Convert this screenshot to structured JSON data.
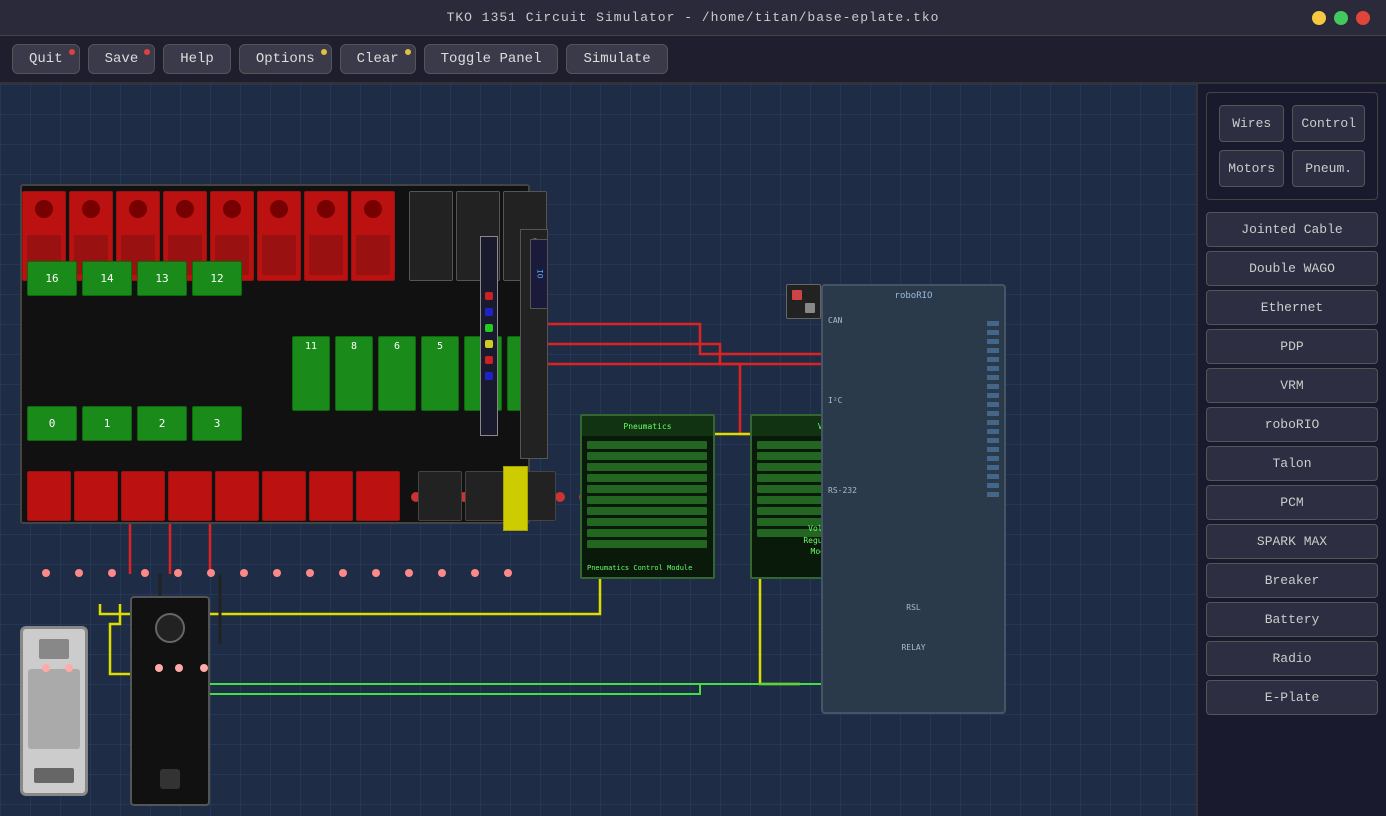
{
  "titlebar": {
    "title": "TKO 1351 Circuit Simulator - /home/titan/base-eplate.tko"
  },
  "window_controls": {
    "minimize_label": "minimize",
    "maximize_label": "maximize",
    "close_label": "close"
  },
  "toolbar": {
    "buttons": [
      {
        "id": "quit",
        "label": "Quit",
        "dot": "red"
      },
      {
        "id": "save",
        "label": "Save",
        "dot": "red"
      },
      {
        "id": "help",
        "label": "Help",
        "dot": "none"
      },
      {
        "id": "options",
        "label": "Options",
        "dot": "yellow"
      },
      {
        "id": "clear",
        "label": "Clear",
        "dot": "yellow"
      },
      {
        "id": "toggle-panel",
        "label": "Toggle Panel",
        "dot": "none"
      },
      {
        "id": "simulate",
        "label": "Simulate",
        "dot": "none"
      }
    ]
  },
  "top_panel": {
    "buttons": [
      {
        "id": "wires",
        "label": "Wires"
      },
      {
        "id": "control",
        "label": "Control"
      },
      {
        "id": "motors",
        "label": "Motors"
      },
      {
        "id": "pneum",
        "label": "Pneum."
      }
    ]
  },
  "components": [
    {
      "id": "jointed-cable",
      "label": "Jointed Cable"
    },
    {
      "id": "double-wago",
      "label": "Double WAGO"
    },
    {
      "id": "ethernet",
      "label": "Ethernet"
    },
    {
      "id": "pdp",
      "label": "PDP"
    },
    {
      "id": "vrm",
      "label": "VRM"
    },
    {
      "id": "roborio",
      "label": "roboRIO"
    },
    {
      "id": "talon",
      "label": "Talon"
    },
    {
      "id": "pcm",
      "label": "PCM"
    },
    {
      "id": "spark-max",
      "label": "SPARK MAX"
    },
    {
      "id": "breaker",
      "label": "Breaker"
    },
    {
      "id": "battery",
      "label": "Battery"
    },
    {
      "id": "radio",
      "label": "Radio"
    },
    {
      "id": "e-plate",
      "label": "E-Plate"
    }
  ],
  "canvas": {
    "grid_color": "#2a4060"
  }
}
